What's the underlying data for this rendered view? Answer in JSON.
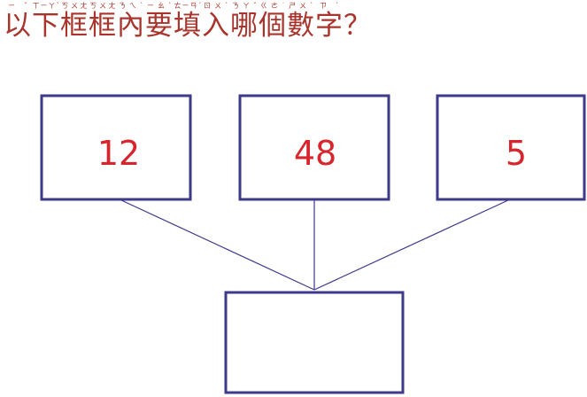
{
  "question": {
    "text": "以下框框內要填入哪個數字？",
    "chars": [
      {
        "char": "以",
        "zhuyin": "ㄧˇ"
      },
      {
        "char": "下",
        "zhuyin": "ㄒㄧㄚˋ"
      },
      {
        "char": "框",
        "zhuyin": "ㄎㄨㄤ"
      },
      {
        "char": "框",
        "zhuyin": "ㄎㄨㄤ"
      },
      {
        "char": "內",
        "zhuyin": "ㄋㄟˋ"
      },
      {
        "char": "要",
        "zhuyin": "ㄧㄠˋ"
      },
      {
        "char": "填",
        "zhuyin": "ㄊㄧㄢˊ"
      },
      {
        "char": "入",
        "zhuyin": "ㄖㄨˋ"
      },
      {
        "char": "哪",
        "zhuyin": "ㄋㄚˇ"
      },
      {
        "char": "個",
        "zhuyin": "ㄍㄜ˙"
      },
      {
        "char": "數",
        "zhuyin": "ㄕㄨˋ"
      },
      {
        "char": "字",
        "zhuyin": "ㄗˋ"
      },
      {
        "char": "？",
        "zhuyin": ""
      }
    ]
  },
  "boxes": {
    "left": "12",
    "middle": "48",
    "right": "5",
    "answer": ""
  },
  "colors": {
    "question_text": "#a8342c",
    "box_border": "#3d3a8c",
    "number_text": "#d8242c"
  }
}
